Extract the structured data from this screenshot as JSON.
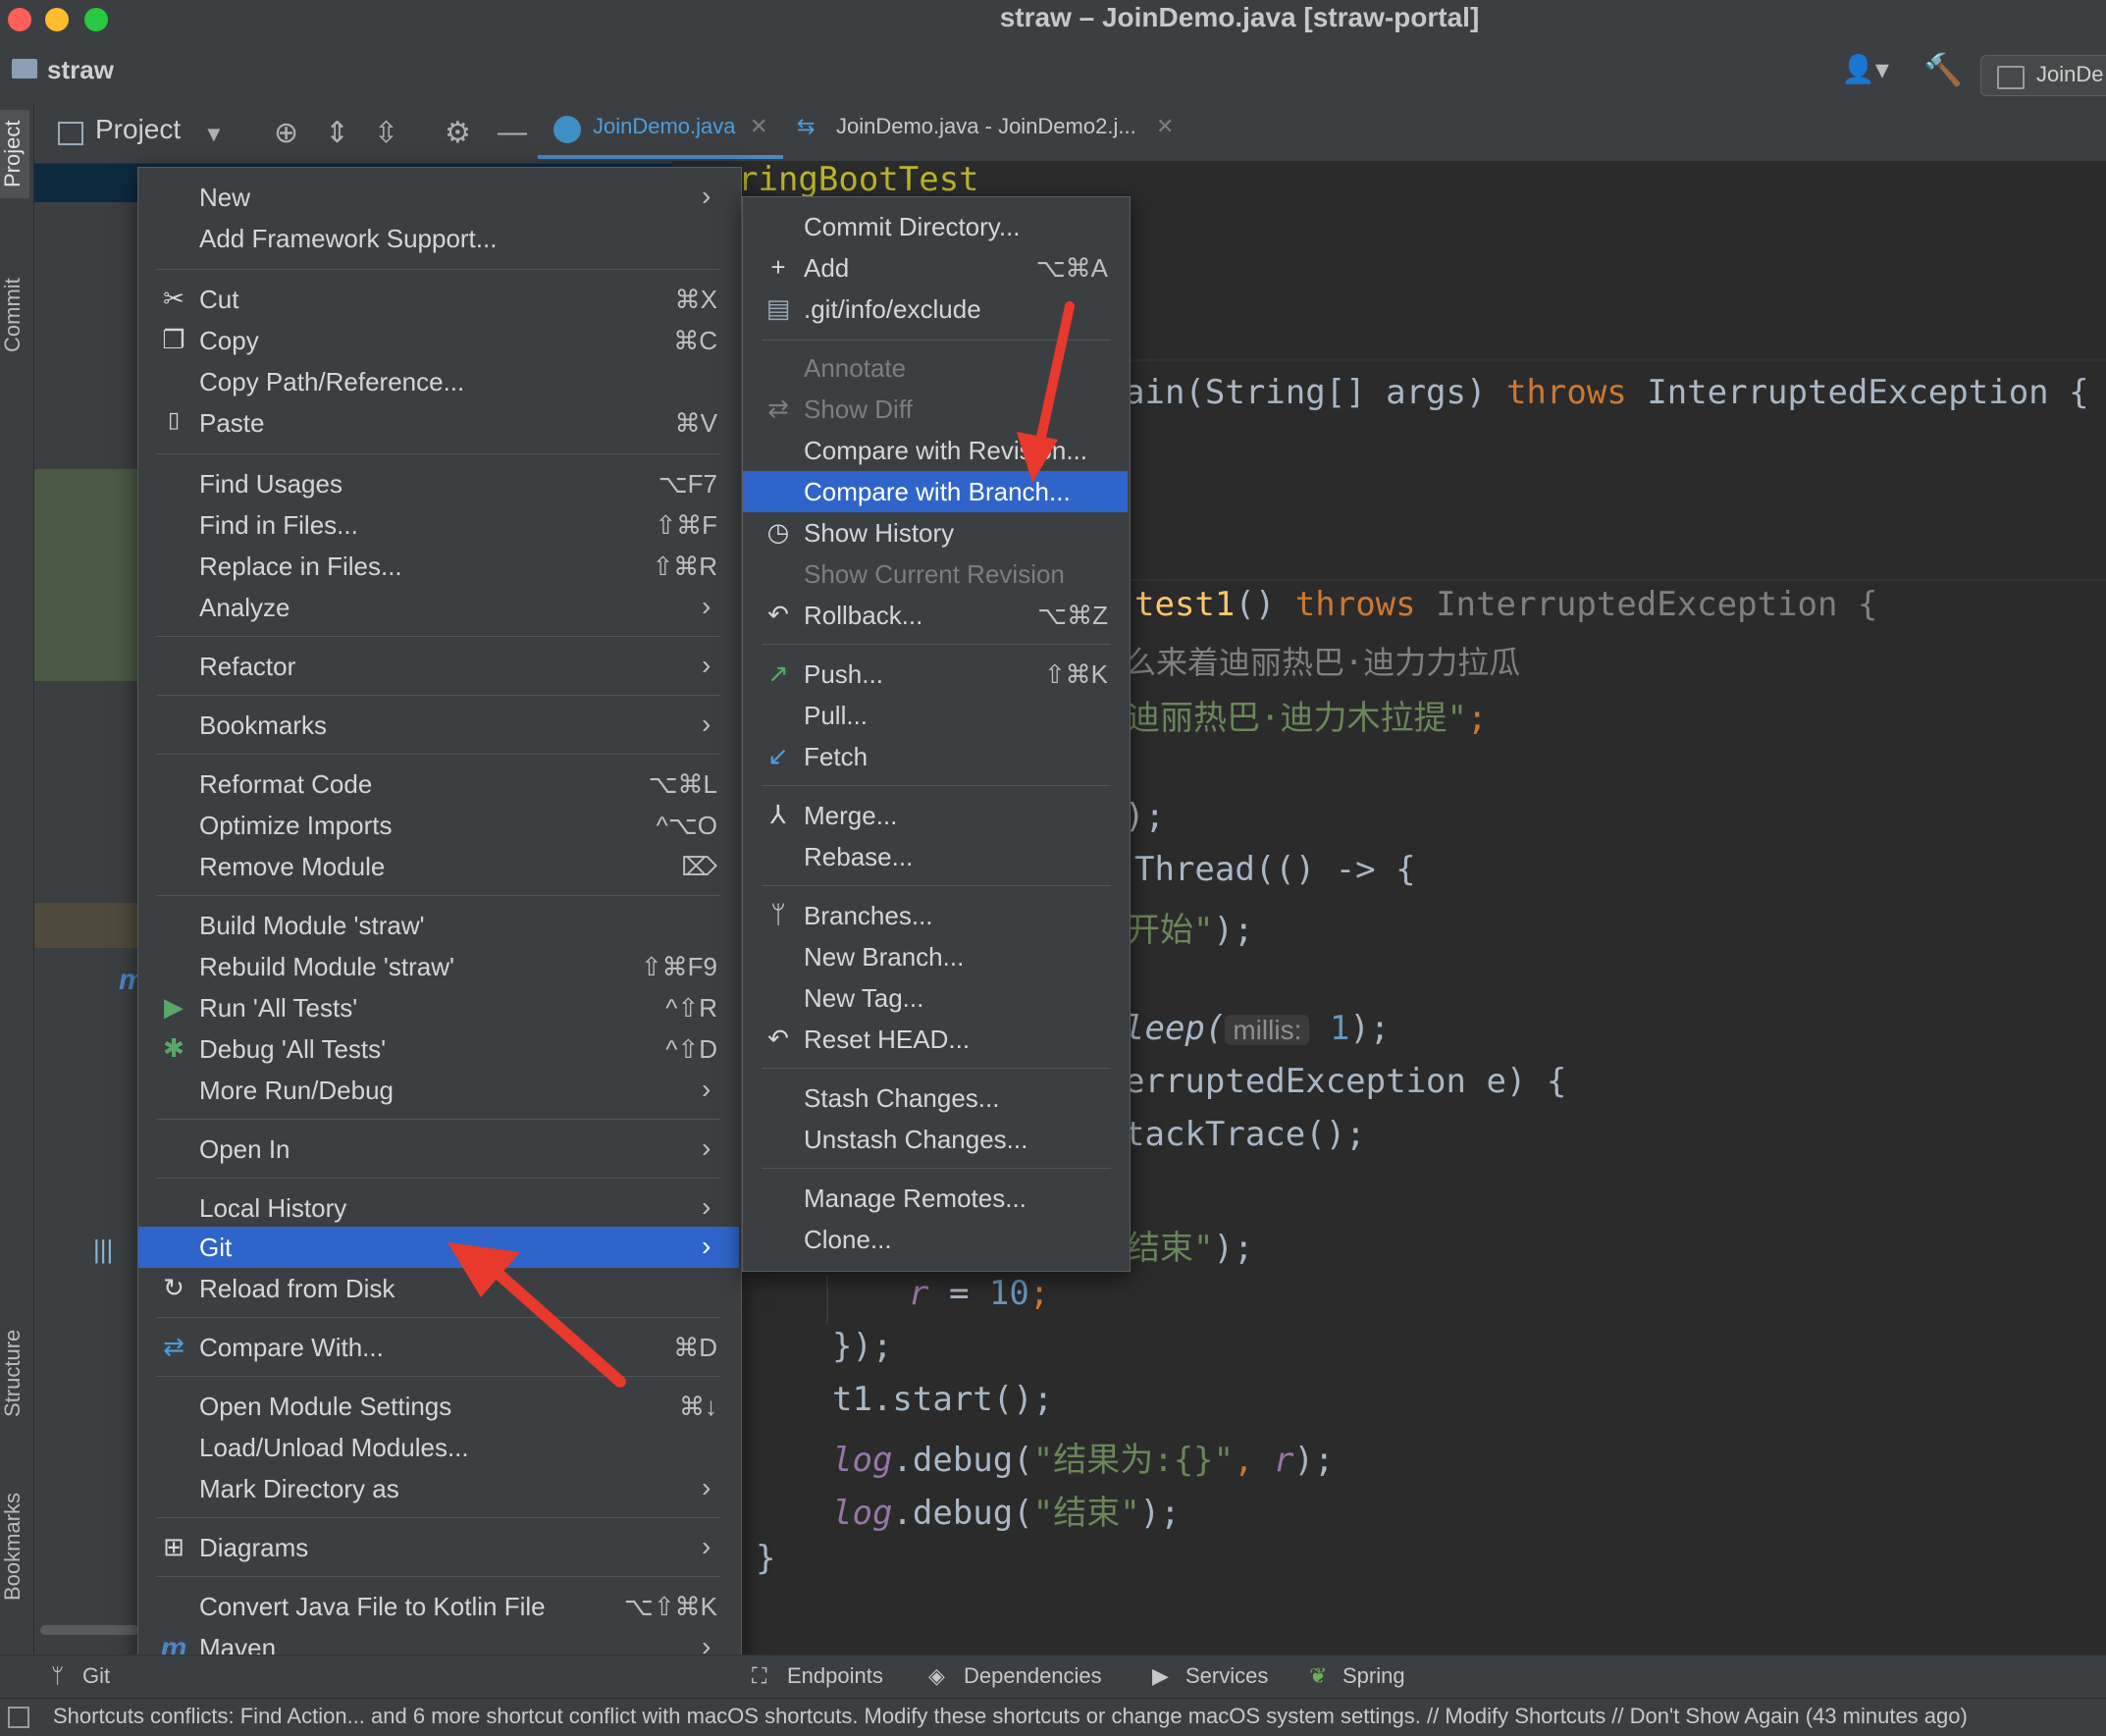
{
  "window": {
    "title": "straw – JoinDemo.java [straw-portal]",
    "project_name": "straw",
    "run_config": "JoinDe"
  },
  "left_strip": {
    "project": "Project",
    "commit": "Commit",
    "structure": "Structure",
    "bookmarks": "Bookmarks"
  },
  "project_panel": {
    "title": "Project"
  },
  "tabs": [
    {
      "label": "JoinDemo.java"
    },
    {
      "label": "JoinDemo.java - JoinDemo2.j..."
    }
  ],
  "code_lines": [
    {
      "t1": "ringBootTest"
    },
    {
      "t1": "ain(String[] args) ",
      "kw": "throws",
      "t2": " InterruptedException {"
    },
    {
      "fn": "test1",
      "t1": "() ",
      "kw": "throws",
      "t2": " InterruptedException {"
    },
    {
      "t1": "么来着迪丽热巴·迪力力拉瓜"
    },
    {
      "s": "迪丽热巴·迪力木拉提\"",
      "t": ";"
    },
    {
      "t1": ");"
    },
    {
      "t1": "Thread(() -> {"
    },
    {
      "s": "开始\"",
      "t": ");"
    },
    {
      "t1": "leep(",
      "hint": "millis:",
      "n": "1",
      "t2": ");"
    },
    {
      "t1": "erruptedException e) {"
    },
    {
      "t1": "tackTrace();"
    },
    {
      "s": "结束\"",
      "t": ");"
    },
    {
      "v": "r",
      "t1": " = ",
      "n": "10",
      "t2": ";"
    },
    {
      "t1": "});"
    },
    {
      "t1": "t1.start();"
    },
    {
      "v": "log",
      "t1": ".debug(",
      "s": "\"结果为:{}\"",
      "t2": ", ",
      "v2": "r",
      "t3": ");"
    },
    {
      "v": "log",
      "t1": ".debug(",
      "s": "\"结束\"",
      "t2": ");"
    },
    {
      "t1": "}"
    }
  ],
  "context_menu": {
    "items": [
      {
        "label": "New",
        "arrow": "›"
      },
      {
        "label": "Add Framework Support..."
      },
      {
        "label": "Cut",
        "shortcut": "⌘X",
        "icon": "✂"
      },
      {
        "label": "Copy",
        "shortcut": "⌘C",
        "icon": "❐"
      },
      {
        "label": "Copy Path/Reference..."
      },
      {
        "label": "Paste",
        "shortcut": "⌘V",
        "icon": "📋"
      },
      {
        "label": "Find Usages",
        "shortcut": "⌥F7"
      },
      {
        "label": "Find in Files...",
        "shortcut": "⇧⌘F"
      },
      {
        "label": "Replace in Files...",
        "shortcut": "⇧⌘R"
      },
      {
        "label": "Analyze",
        "arrow": "›"
      },
      {
        "label": "Refactor",
        "arrow": "›"
      },
      {
        "label": "Bookmarks",
        "arrow": "›"
      },
      {
        "label": "Reformat Code",
        "shortcut": "⌥⌘L"
      },
      {
        "label": "Optimize Imports",
        "shortcut": "^⌥O"
      },
      {
        "label": "Remove Module",
        "shortcut": "⌦"
      },
      {
        "label": "Build Module 'straw'"
      },
      {
        "label": "Rebuild Module 'straw'",
        "shortcut": "⇧⌘F9"
      },
      {
        "label": "Run 'All Tests'",
        "shortcut": "^⇧R",
        "icon": "▶"
      },
      {
        "label": "Debug 'All Tests'",
        "shortcut": "^⇧D",
        "icon": "✱"
      },
      {
        "label": "More Run/Debug",
        "arrow": "›"
      },
      {
        "label": "Open In",
        "arrow": "›"
      },
      {
        "label": "Local History",
        "arrow": "›"
      },
      {
        "label": "Git",
        "arrow": "›"
      },
      {
        "label": "Reload from Disk",
        "icon": "↻"
      },
      {
        "label": "Compare With...",
        "shortcut": "⌘D",
        "icon": "⇄"
      },
      {
        "label": "Open Module Settings",
        "shortcut": "⌘↓"
      },
      {
        "label": "Load/Unload Modules..."
      },
      {
        "label": "Mark Directory as",
        "arrow": "›"
      },
      {
        "label": "Diagrams",
        "arrow": "›",
        "icon": "⊞"
      },
      {
        "label": "Convert Java File to Kotlin File",
        "shortcut": "⌥⇧⌘K"
      },
      {
        "label": "Maven",
        "arrow": "›",
        "icon": "m"
      }
    ]
  },
  "git_submenu": {
    "items": [
      {
        "label": "Commit Directory..."
      },
      {
        "label": "Add",
        "shortcut": "⌥⌘A",
        "icon": "+"
      },
      {
        "label": ".git/info/exclude",
        "icon": "▤"
      },
      {
        "label": "Annotate"
      },
      {
        "label": "Show Diff",
        "icon": "⇄"
      },
      {
        "label": "Compare with Revision..."
      },
      {
        "label": "Compare with Branch..."
      },
      {
        "label": "Show History",
        "icon": "◷"
      },
      {
        "label": "Show Current Revision"
      },
      {
        "label": "Rollback...",
        "shortcut": "⌥⌘Z",
        "icon": "↶"
      },
      {
        "label": "Push...",
        "shortcut": "⇧⌘K",
        "icon": "↗"
      },
      {
        "label": "Pull..."
      },
      {
        "label": "Fetch",
        "icon": "↙"
      },
      {
        "label": "Merge...",
        "icon": "⅄"
      },
      {
        "label": "Rebase..."
      },
      {
        "label": "Branches...",
        "icon": "ᛘ"
      },
      {
        "label": "New Branch..."
      },
      {
        "label": "New Tag..."
      },
      {
        "label": "Reset HEAD...",
        "icon": "↶"
      },
      {
        "label": "Stash Changes..."
      },
      {
        "label": "Unstash Changes..."
      },
      {
        "label": "Manage Remotes..."
      },
      {
        "label": "Clone..."
      }
    ]
  },
  "bottom_tools": [
    {
      "label": "Git"
    },
    {
      "label": "Endpoints"
    },
    {
      "label": "Dependencies"
    },
    {
      "label": "Services"
    },
    {
      "label": "Spring"
    }
  ],
  "status": {
    "message": "Shortcuts conflicts: Find Action... and 6 more shortcut conflict with macOS shortcuts. Modify these shortcuts or change macOS system settings. // Modify Shortcuts // Don't Show Again (43 minutes ago)"
  },
  "colors": {
    "accent": "#2f65ca",
    "annotation_arrow": "#e8392c"
  }
}
